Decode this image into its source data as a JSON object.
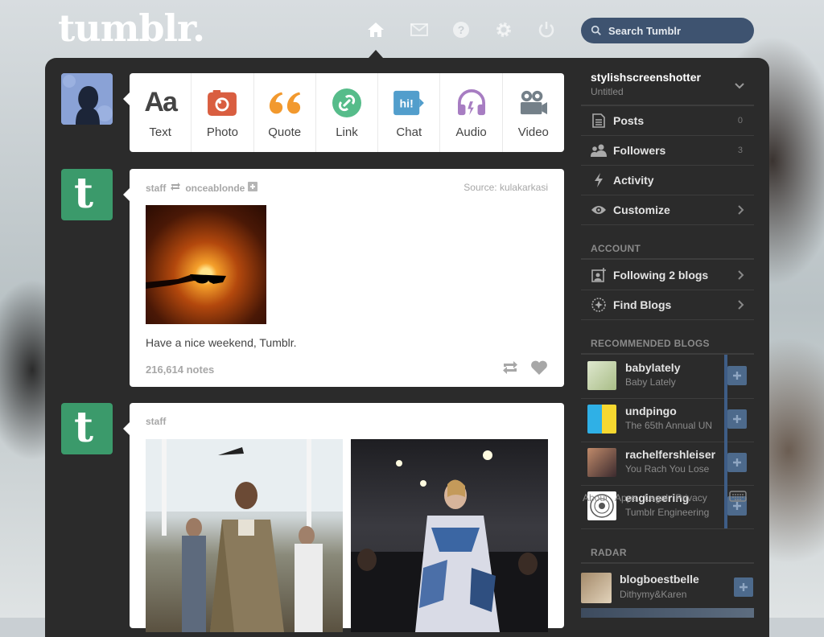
{
  "header": {
    "logo": "tumblr.",
    "search_placeholder": "Search Tumblr",
    "nav": [
      "home-icon",
      "mail-icon",
      "help-icon",
      "gear-icon",
      "power-icon"
    ]
  },
  "post_types": [
    {
      "label": "Text",
      "icon": "text-icon",
      "glyph": "Aa",
      "color": "#444444"
    },
    {
      "label": "Photo",
      "icon": "camera-icon",
      "color": "#d95e40"
    },
    {
      "label": "Quote",
      "icon": "quote-icon",
      "color": "#f2992e"
    },
    {
      "label": "Link",
      "icon": "link-icon",
      "color": "#56bc8a"
    },
    {
      "label": "Chat",
      "icon": "chat-icon",
      "glyph": "hi!",
      "color": "#529ecc"
    },
    {
      "label": "Audio",
      "icon": "headphones-icon",
      "color": "#a77dc2"
    },
    {
      "label": "Video",
      "icon": "video-camera-icon",
      "color": "#748089"
    }
  ],
  "posts": [
    {
      "author": "staff",
      "reblogged_from": "onceablonde",
      "source_label": "Source:",
      "source": "kulakarkasi",
      "caption": "Have a nice weekend, Tumblr.",
      "notes": "216,614 notes"
    },
    {
      "author": "staff"
    }
  ],
  "sidebar": {
    "blog_name": "stylishscreenshotter",
    "blog_subtitle": "Untitled",
    "rows": [
      {
        "label": "Posts",
        "count": "0",
        "icon": "document-icon"
      },
      {
        "label": "Followers",
        "count": "3",
        "icon": "followers-icon"
      },
      {
        "label": "Activity",
        "icon": "lightning-icon"
      },
      {
        "label": "Customize",
        "icon": "eye-icon"
      }
    ],
    "account_heading": "ACCOUNT",
    "account_rows": [
      {
        "label": "Following 2 blogs",
        "icon": "add-person-icon"
      },
      {
        "label": "Find Blogs",
        "icon": "compass-icon"
      }
    ],
    "recommended_heading": "RECOMMENDED BLOGS",
    "recommended": [
      {
        "name": "babylately",
        "subtitle": "Baby Lately",
        "thumb_color": "#c9d8b4"
      },
      {
        "name": "undpingo",
        "subtitle": "The 65th Annual UN",
        "thumb_color": "#f6d830"
      },
      {
        "name": "rachelfershleiser",
        "subtitle": "You Rach You Lose",
        "thumb_color": "#6a4a4e"
      },
      {
        "name": "engineering",
        "subtitle": "Tumblr Engineering",
        "thumb_color": "#ffffff"
      }
    ],
    "footer_links": [
      "About",
      "Apps",
      "Legal",
      "Privacy"
    ],
    "radar_heading": "RADAR",
    "radar": {
      "name": "blogboestbelle",
      "subtitle": "Dithymy&Karen"
    }
  }
}
